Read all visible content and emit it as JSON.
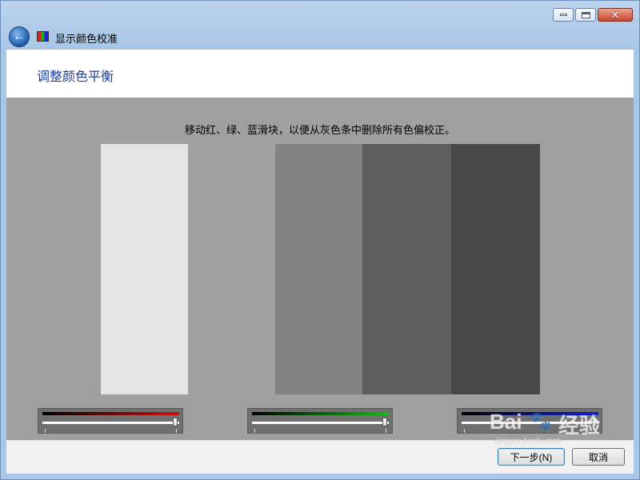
{
  "window": {
    "title": "显示颜色校准",
    "icon": "monitor-color-icon",
    "caption_buttons": [
      "minimize-icon",
      "maximize-icon",
      "close-icon"
    ]
  },
  "page": {
    "heading": "调整颜色平衡",
    "instruction": "移动红、绿、蓝滑块，以便从灰色条中删除所有色偏校正。"
  },
  "gray_bars": [
    "#e4e4e4",
    "#a1a1a1",
    "#838383",
    "#5d5d5d",
    "#484848"
  ],
  "sliders": [
    {
      "channel": "red",
      "gradient_color": "#d01010",
      "value": 1.0
    },
    {
      "channel": "green",
      "gradient_color": "#10c010",
      "value": 1.0
    },
    {
      "channel": "blue",
      "gradient_color": "#1020d8",
      "value": 1.0
    }
  ],
  "buttons": {
    "next": "下一步(N)",
    "cancel": "取消"
  },
  "watermark": {
    "brand": "Bai",
    "suffix": "经验",
    "url": "jingyan.baidu.com"
  }
}
